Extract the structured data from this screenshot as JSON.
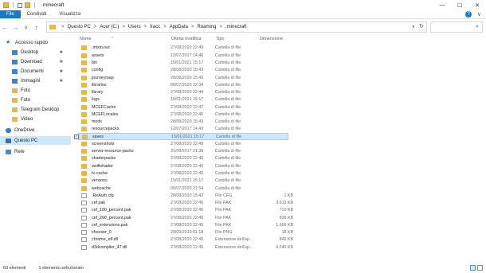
{
  "window": {
    "title": ".minecraft",
    "controls": {
      "minimize": "—",
      "maximize": "☐",
      "close": "✕"
    }
  },
  "ribbon": {
    "tabs": [
      "File",
      "Condividi",
      "Visualizza"
    ],
    "expand": "∨",
    "help": "?"
  },
  "nav": {
    "back": "←",
    "forward": "→",
    "recent": "∨",
    "up": "↑"
  },
  "address": {
    "crumbs": [
      "Questo PC",
      "Acer (C:)",
      "Users",
      "fracc",
      "AppData",
      "Roaming",
      ".minecraft"
    ],
    "separator": ">",
    "dropdown": "∨",
    "refresh": "↻"
  },
  "search": {
    "icon": "⌕"
  },
  "sidebar": {
    "items": [
      {
        "label": "Accesso rapido",
        "icon": "star-icon",
        "pinned": false
      },
      {
        "label": "Desktop",
        "icon": "desktop-folder-icon",
        "pinned": true
      },
      {
        "label": "Download",
        "icon": "download-folder-icon",
        "pinned": true
      },
      {
        "label": "Documenti",
        "icon": "documents-folder-icon",
        "pinned": true
      },
      {
        "label": "Immagini",
        "icon": "pictures-folder-icon",
        "pinned": true
      },
      {
        "label": "Foto",
        "icon": "folder-icon",
        "pinned": false
      },
      {
        "label": "Foto",
        "icon": "folder-icon",
        "pinned": false
      },
      {
        "label": "Telegram Desktop",
        "icon": "folder-icon",
        "pinned": false
      },
      {
        "label": "Video",
        "icon": "folder-icon",
        "pinned": false
      },
      {
        "label": "OneDrive",
        "icon": "cloud-icon",
        "pinned": false
      },
      {
        "label": "Questo PC",
        "icon": "computer-icon",
        "pinned": false,
        "selected": true
      },
      {
        "label": "Rete",
        "icon": "network-icon",
        "pinned": false
      }
    ],
    "pin_glyph": "✱"
  },
  "columns": {
    "name": "Nome",
    "modified": "Ultima modifica",
    "type": "Tipo",
    "size": "Dimensione"
  },
  "files": [
    {
      "name": ".mixin.out",
      "date": "27/08/2020 22:45",
      "type": "Cartella di file",
      "size": "",
      "kind": "dir"
    },
    {
      "name": "assets",
      "date": "12/07/2017 14:46",
      "type": "Cartella di file",
      "size": "",
      "kind": "dir"
    },
    {
      "name": "bin",
      "date": "15/01/2021 15:17",
      "type": "Cartella di file",
      "size": "",
      "kind": "dir"
    },
    {
      "name": "config",
      "date": "28/08/2020 15:43",
      "type": "Cartella di file",
      "size": "",
      "kind": "dir"
    },
    {
      "name": "journeymap",
      "date": "28/08/2020 15:43",
      "type": "Cartella di file",
      "size": "",
      "kind": "dir"
    },
    {
      "name": "libraries",
      "date": "06/07/2020 22:04",
      "type": "Cartella di file",
      "size": "",
      "kind": "dir"
    },
    {
      "name": "library",
      "date": "27/08/2020 22:44",
      "type": "Cartella di file",
      "size": "",
      "kind": "dir"
    },
    {
      "name": "logs",
      "date": "15/01/2021 15:17",
      "type": "Cartella di file",
      "size": "",
      "kind": "dir"
    },
    {
      "name": "MCEFCache",
      "date": "27/08/2020 22:47",
      "type": "Cartella di file",
      "size": "",
      "kind": "dir"
    },
    {
      "name": "MCEFLocales",
      "date": "27/08/2020 22:46",
      "type": "Cartella di file",
      "size": "",
      "kind": "dir"
    },
    {
      "name": "mods",
      "date": "28/08/2020 15:43",
      "type": "Cartella di file",
      "size": "",
      "kind": "dir"
    },
    {
      "name": "resourcepacks",
      "date": "12/07/2017 14:43",
      "type": "Cartella di file",
      "size": "",
      "kind": "dir"
    },
    {
      "name": "saves",
      "date": "15/01/2021 15:17",
      "type": "Cartella di file",
      "size": "",
      "kind": "dir",
      "selected": true
    },
    {
      "name": "screenshots",
      "date": "27/08/2020 22:49",
      "type": "Cartella di file",
      "size": "",
      "kind": "dir"
    },
    {
      "name": "server-resource-packs",
      "date": "31/08/2017 21:39",
      "type": "Cartella di file",
      "size": "",
      "kind": "dir"
    },
    {
      "name": "shaderpacks",
      "date": "27/08/2020 22:46",
      "type": "Cartella di file",
      "size": "",
      "kind": "dir"
    },
    {
      "name": "swiftshader",
      "date": "27/08/2020 22:46",
      "type": "Cartella di file",
      "size": "",
      "kind": "dir"
    },
    {
      "name": "tv-cache",
      "date": "27/08/2020 22:45",
      "type": "Cartella di file",
      "size": "",
      "kind": "dir"
    },
    {
      "name": "versions",
      "date": "15/01/2021 15:17",
      "type": "Cartella di file",
      "size": "",
      "kind": "dir"
    },
    {
      "name": "webcache",
      "date": "06/07/2020 21:54",
      "type": "Cartella di file",
      "size": "",
      "kind": "dir"
    },
    {
      "name": ".ReAuth.cfg",
      "date": "28/08/2020 15:42",
      "type": "File CFG",
      "size": "1 KB",
      "kind": "file"
    },
    {
      "name": "cef.pak",
      "date": "27/08/2020 22:45",
      "type": "File PAK",
      "size": "3.613 KB",
      "kind": "file"
    },
    {
      "name": "cef_100_percent.pak",
      "date": "27/08/2020 22:45",
      "type": "File PAK",
      "size": "710 KB",
      "kind": "file"
    },
    {
      "name": "cef_200_percent.pak",
      "date": "27/08/2020 22:45",
      "type": "File PAK",
      "size": "838 KB",
      "kind": "file"
    },
    {
      "name": "cef_extensions.pak",
      "date": "27/08/2020 22:45",
      "type": "File PAK",
      "size": "1.666 KB",
      "kind": "file"
    },
    {
      "name": "chooser_0",
      "date": "20/09/2019 01:18",
      "type": "File PNG",
      "size": "18 KB",
      "kind": "file"
    },
    {
      "name": "chrome_elf.dll",
      "date": "27/08/2020 22:45",
      "type": "Estensione dell'ap...",
      "size": "849 KB",
      "kind": "file"
    },
    {
      "name": "d3dcompiler_47.dll",
      "date": "27/08/2020 22:45",
      "type": "Estensione dell'ap...",
      "size": "4.245 KB",
      "kind": "file"
    }
  ],
  "status": {
    "count": "60 elementi",
    "selection": "1 elemento selezionato"
  }
}
